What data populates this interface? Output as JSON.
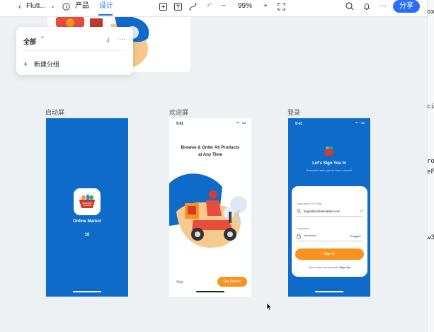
{
  "toolbar": {
    "title": "Flutt...",
    "tab_product": "产品",
    "tab_design": "设计",
    "zoom": "99%",
    "zoom_minus": "−",
    "zoom_plus": "+",
    "share_label": "分享"
  },
  "popup": {
    "title": "全部",
    "count": "4",
    "more": "···",
    "new_group_icon": "+",
    "new_group": "新建分组"
  },
  "frames": [
    {
      "label": "启动屏"
    },
    {
      "label": "欢迎屏"
    },
    {
      "label": "登录"
    }
  ],
  "splash": {
    "app_name": "Online Market",
    "version": "10"
  },
  "welcome": {
    "time": "9:41",
    "headline_1": "Browse & Order All Products",
    "headline_2": "at Any Time",
    "skip": "Skip",
    "get_started": "Get Started"
  },
  "signin": {
    "time": "9:41",
    "title": "Let's Sign You In",
    "subtitle": "Welcome back, you've been missed!",
    "username_label": "Username or E-Mail",
    "username_value": "bugra@onlinemarket.com",
    "password_label": "Password",
    "password_value": "**********",
    "forgot": "Forgot?",
    "signin_button": "Sign In",
    "no_account": "Don't have an account?",
    "signup": "Sign Up"
  },
  "right_panel_fragments": [
    "ox",
    "ci",
    "ro",
    "eF",
    "w3"
  ],
  "colors": {
    "primary_blue": "#0f6bc9",
    "orange": "#f7931e",
    "share_blue": "#2b6ff6"
  }
}
